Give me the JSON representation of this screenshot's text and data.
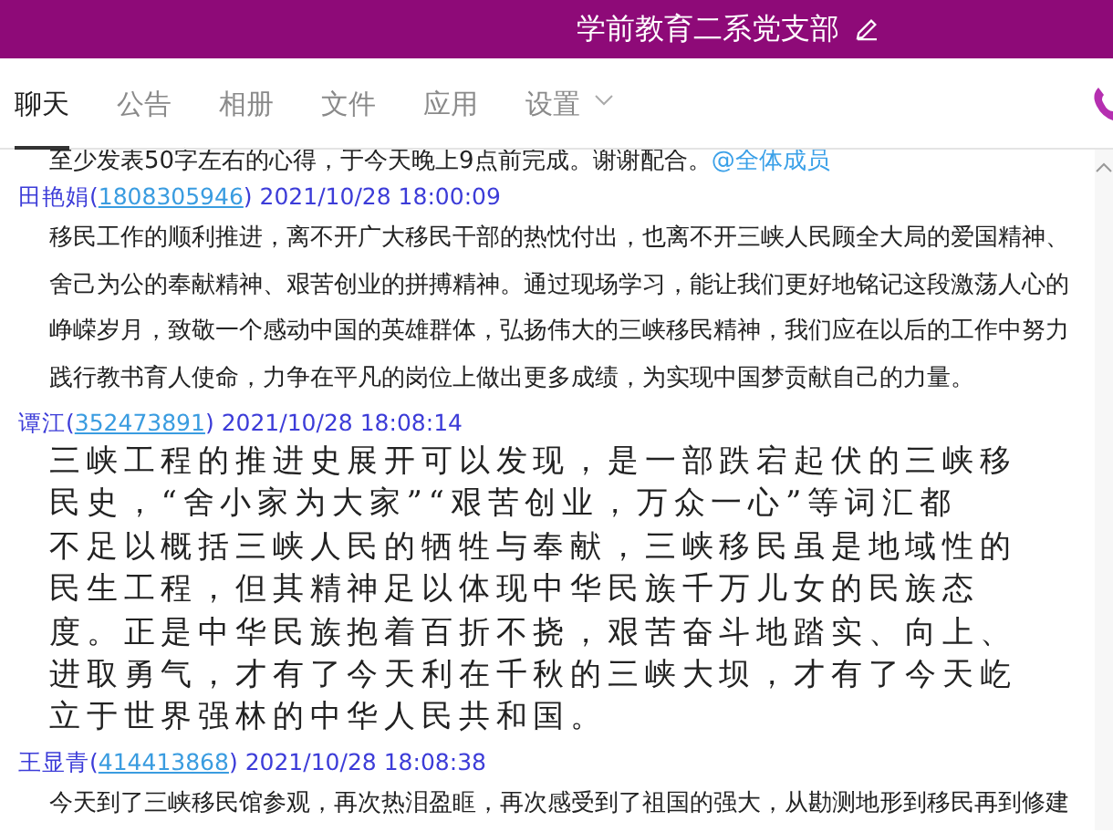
{
  "group": {
    "title": "学前教育二系党支部"
  },
  "tabs": [
    {
      "label": "聊天",
      "selected": true,
      "has_menu": false
    },
    {
      "label": "公告",
      "selected": false,
      "has_menu": false
    },
    {
      "label": "相册",
      "selected": false,
      "has_menu": false
    },
    {
      "label": "文件",
      "selected": false,
      "has_menu": false
    },
    {
      "label": "应用",
      "selected": false,
      "has_menu": false
    },
    {
      "label": "设置",
      "selected": false,
      "has_menu": true
    }
  ],
  "pinned_notice": {
    "text": "至少发表50字左右的心得，于今天晚上9点前完成。谢谢配合。",
    "mention": "@全体成员"
  },
  "messages": [
    {
      "sender": "田艳娟(",
      "qq": "1808305946",
      "time": ") 2021/10/28 18:00:09",
      "kind": "plain",
      "text": "移民工作的顺利推进，离不开广大移民干部的热忱付出，也离不开三峡人民顾全大局的爱国精神、舍己为公的奉献精神、艰苦创业的拼搏精神。通过现场学习，能让我们更好地铭记这段激荡人心的峥嵘岁月，致敬一个感动中国的英雄群体，弘扬伟大的三峡移民精神，我们应在以后的工作中努力践行教书育人使命，力争在平凡的岗位上做出更多成绩，为实现中国梦贡献自己的力量。"
    },
    {
      "sender": "谭江(",
      "qq": "352473891",
      "time": ") 2021/10/28 18:08:14",
      "kind": "large",
      "lines": [
        "三峡工程的推进史展开可以发现，是一部跌宕起伏的三峡移",
        "民史，“舍小家为大家”“艰苦创业，万众一心”等词汇都",
        "不足以概括三峡人民的牺牲与奉献，三峡移民虽是地域性的",
        "民生工程，但其精神足以体现中华民族千万儿女的民族态",
        "度。正是中华民族抱着百折不挠，艰苦奋斗地踏实、向上、",
        "进取勇气，才有了今天利在千秋的三峡大坝，才有了今天屹",
        "立于世界强林的中华人民共和国。"
      ]
    },
    {
      "sender": "王显青(",
      "qq": "414413868",
      "time": ") 2021/10/28 18:08:38",
      "kind": "plain",
      "text": "今天到了三峡移民馆参观，再次热泪盈眶，再次感受到了祖国的强大，从勘测地形到移民再到修建"
    }
  ]
}
